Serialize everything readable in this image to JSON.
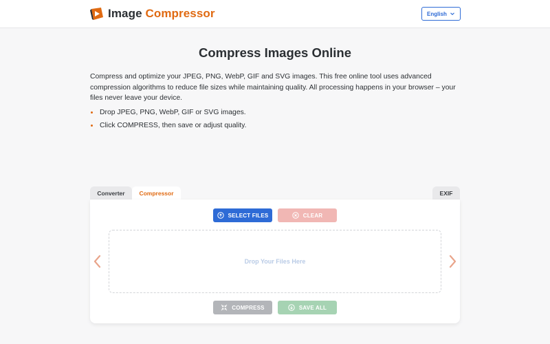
{
  "header": {
    "logo_word1": "Image",
    "logo_word2": "Compressor",
    "language": "English"
  },
  "colors": {
    "accent_orange": "#e06a12",
    "primary_blue": "#2e6bd6",
    "clear_disabled": "#f1b7b4",
    "compress_disabled": "#b3b5b9",
    "saveall_disabled": "#a6d3b3"
  },
  "main": {
    "title": "Compress Images Online",
    "intro": "Compress and optimize your JPEG, PNG, WebP, GIF and SVG images. This free online tool uses advanced compression algorithms to reduce file sizes while maintaining quality. All processing happens in your browser – your files never leave your device.",
    "bullets": [
      "Drop JPEG, PNG, WebP, GIF or SVG images.",
      "Click COMPRESS, then save or adjust quality."
    ]
  },
  "tabs": {
    "converter": "Converter",
    "compressor": "Compressor",
    "exif": "EXIF"
  },
  "tool": {
    "select_files": "SELECT FILES",
    "clear": "CLEAR",
    "drop_hint": "Drop Your Files Here",
    "compress": "COMPRESS",
    "save_all": "SAVE ALL"
  },
  "icons": {
    "logo": "play-logo-icon",
    "language_chevron": "chevron-down-icon",
    "select": "upload-circle-icon",
    "clear": "x-circle-icon",
    "compress": "compress-arrows-icon",
    "save_all": "download-circle-icon",
    "prev": "chevron-left-icon",
    "next": "chevron-right-icon"
  }
}
